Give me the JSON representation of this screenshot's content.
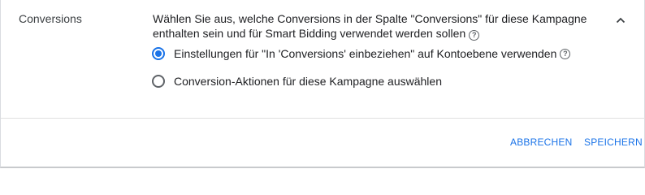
{
  "section": {
    "label": "Conversions"
  },
  "description": {
    "text": "Wählen Sie aus, welche Conversions in der Spalte \"Conversions\" für diese Kampagne enthalten sein und für Smart Bidding verwendet werden sollen",
    "help_icon": "help-circle-icon"
  },
  "collapse_icon": "chevron-up-icon",
  "options": [
    {
      "label": "Einstellungen für \"In 'Conversions' einbeziehen\" auf Kontoebene verwenden",
      "selected": true,
      "help_icon": "help-circle-icon"
    },
    {
      "label": "Conversion-Aktionen für diese Kampagne auswählen",
      "selected": false
    }
  ],
  "actions": {
    "cancel_label": "ABBRECHEN",
    "save_label": "SPEICHERN"
  },
  "colors": {
    "accent": "#1a73e8",
    "text": "#202124",
    "muted": "#5f6368",
    "divider": "#e0e0e0"
  }
}
